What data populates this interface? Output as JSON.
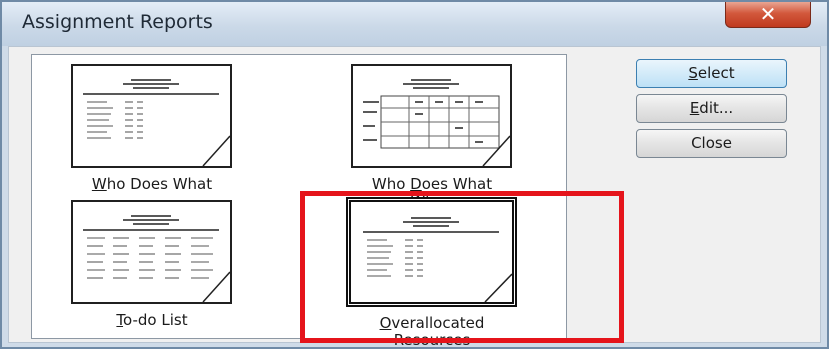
{
  "window": {
    "title": "Assignment Reports",
    "close_glyph": "✕",
    "highlight_color": "#e5141b"
  },
  "reports": [
    {
      "label": "Who Does What",
      "mnemonic": "W",
      "rest": "ho Does What",
      "icon": "simple-report-icon"
    },
    {
      "label_pre": "Who ",
      "mnemonic": "D",
      "label_post": "oes What",
      "label_line2": "When",
      "icon": "grid-report-icon"
    },
    {
      "mnemonic": "T",
      "rest": "o-do List",
      "icon": "table-report-icon"
    },
    {
      "mnemonic": "O",
      "rest": "verallocated",
      "label_line2": "Resources",
      "icon": "simple-report-icon",
      "selected": true
    }
  ],
  "buttons": {
    "select": {
      "mnemonic": "S",
      "rest": "elect"
    },
    "edit": {
      "mnemonic": "E",
      "rest": "dit..."
    },
    "close": {
      "label": "Close"
    }
  }
}
